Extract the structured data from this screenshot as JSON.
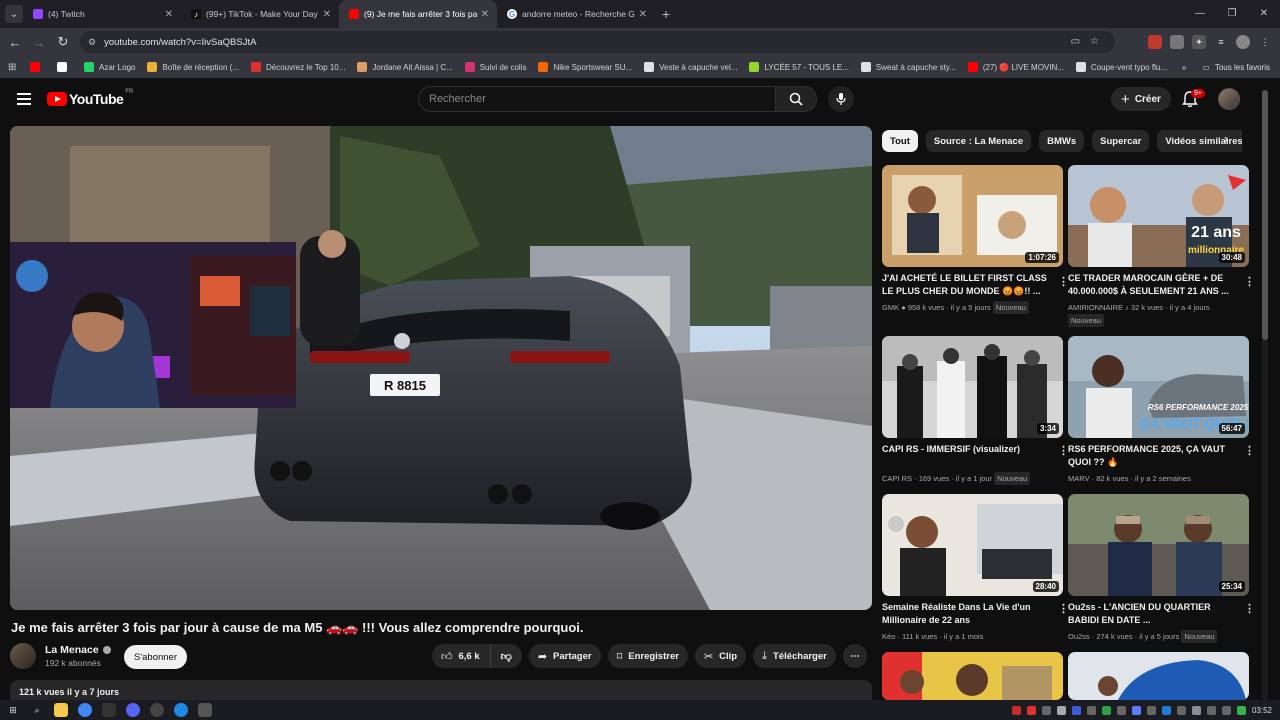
{
  "browser": {
    "tabs": [
      {
        "label": "(4) Twitch",
        "icon": "twitch-icon",
        "color": "#9146ff"
      },
      {
        "label": "(99+) TikTok - Make Your Day",
        "icon": "tiktok-icon",
        "color": "#111111"
      },
      {
        "label": "(9) Je me fais arrêter 3 fois par j",
        "icon": "youtube-icon",
        "color": "#ff0000",
        "active": true
      },
      {
        "label": "andorre meteo - Recherche Go",
        "icon": "google-icon",
        "color": "#4285f4"
      }
    ],
    "url": "youtube.com/watch?v=IivSaQBSJtA",
    "bookmarks": [
      "",
      "",
      "Azar Logo",
      "Boîte de réception (...",
      "Découvrez le Top 10...",
      "Jordane Ait Aissa | C...",
      "Suivi de colis",
      "Nike Sportswear SU...",
      "Veste à capuche vel...",
      "LYCÉE 57 - TOUS LE...",
      "Sweat à capuche sty...",
      "(27) 🔴 LIVE MOVIN...",
      "Coupe-vent typo flu..."
    ],
    "bookmarks_more": "»",
    "all_bookmarks": "Tous les favoris"
  },
  "youtube": {
    "logo": "YouTube",
    "region": "FR",
    "search_placeholder": "Rechercher",
    "create_label": "Créer",
    "notification_count": "9+"
  },
  "video": {
    "title": "Je me fais arrêter 3 fois par jour à cause de ma M5 🚗🚗 !!! Vous allez comprendre pourquoi.",
    "plate": "R 8815",
    "channel": "La Menace",
    "subscribers": "192 k abonnés",
    "subscribe_label": "S'abonner",
    "likes": "6,6 k",
    "share_label": "Partager",
    "save_label": "Enregistrer",
    "clip_label": "Clip",
    "download_label": "Télécharger",
    "views_date": "121 k vues  il y a 7 jours"
  },
  "chips": [
    "Tout",
    "Source : La Menace",
    "BMWs",
    "Supercar",
    "Vidéos similaires"
  ],
  "recommendations": [
    {
      "title": "J'AI ACHETÉ LE BILLET FIRST CLASS LE PLUS CHER DU MONDE 😡😡!! ...",
      "channel": "GMK",
      "meta": "958 k vues · il y a 5 jours",
      "duration": "1:07:26",
      "badge": "Nouveau"
    },
    {
      "title": "CE TRADER MAROCAIN GÈRE + DE 40.000.000$ À SEULEMENT 21 ANS ...",
      "channel": "AMIRIONNAIRE",
      "meta": "32 k vues · il y a 4 jours",
      "duration": "30:48",
      "badge": "Nouveau",
      "overlay": "21 ans",
      "overlay2": "millionnaire"
    },
    {
      "title": "CAPI RS - IMMERSIF (visualizer)",
      "channel": "CAPI RS",
      "meta": "169 vues · il y a 1 jour",
      "duration": "3:34",
      "badge": "Nouveau"
    },
    {
      "title": "RS6 PERFORMANCE 2025, ÇA VAUT QUOI ?? 🔥",
      "channel": "MARV",
      "meta": "82 k vues · il y a 2 semaines",
      "duration": "56:47",
      "overlay": "RS6 PERFORMANCE 2025",
      "overlay2": "ÇA VAUT QUOI ?"
    },
    {
      "title": "Semaine Réaliste Dans La Vie d'un Millionaire de 22 ans",
      "channel": "Kéo",
      "meta": "111 k vues · il y a 1 mois",
      "duration": "28:40"
    },
    {
      "title": "Ou2ss - L'ANCIEN DU QUARTIER BABIDI EN DATE ...",
      "channel": "Ou2ss",
      "meta": "274 k vues · il y a 5 jours",
      "duration": "25:34",
      "badge": "Nouveau"
    }
  ],
  "taskbar": {
    "time": "03:52"
  }
}
